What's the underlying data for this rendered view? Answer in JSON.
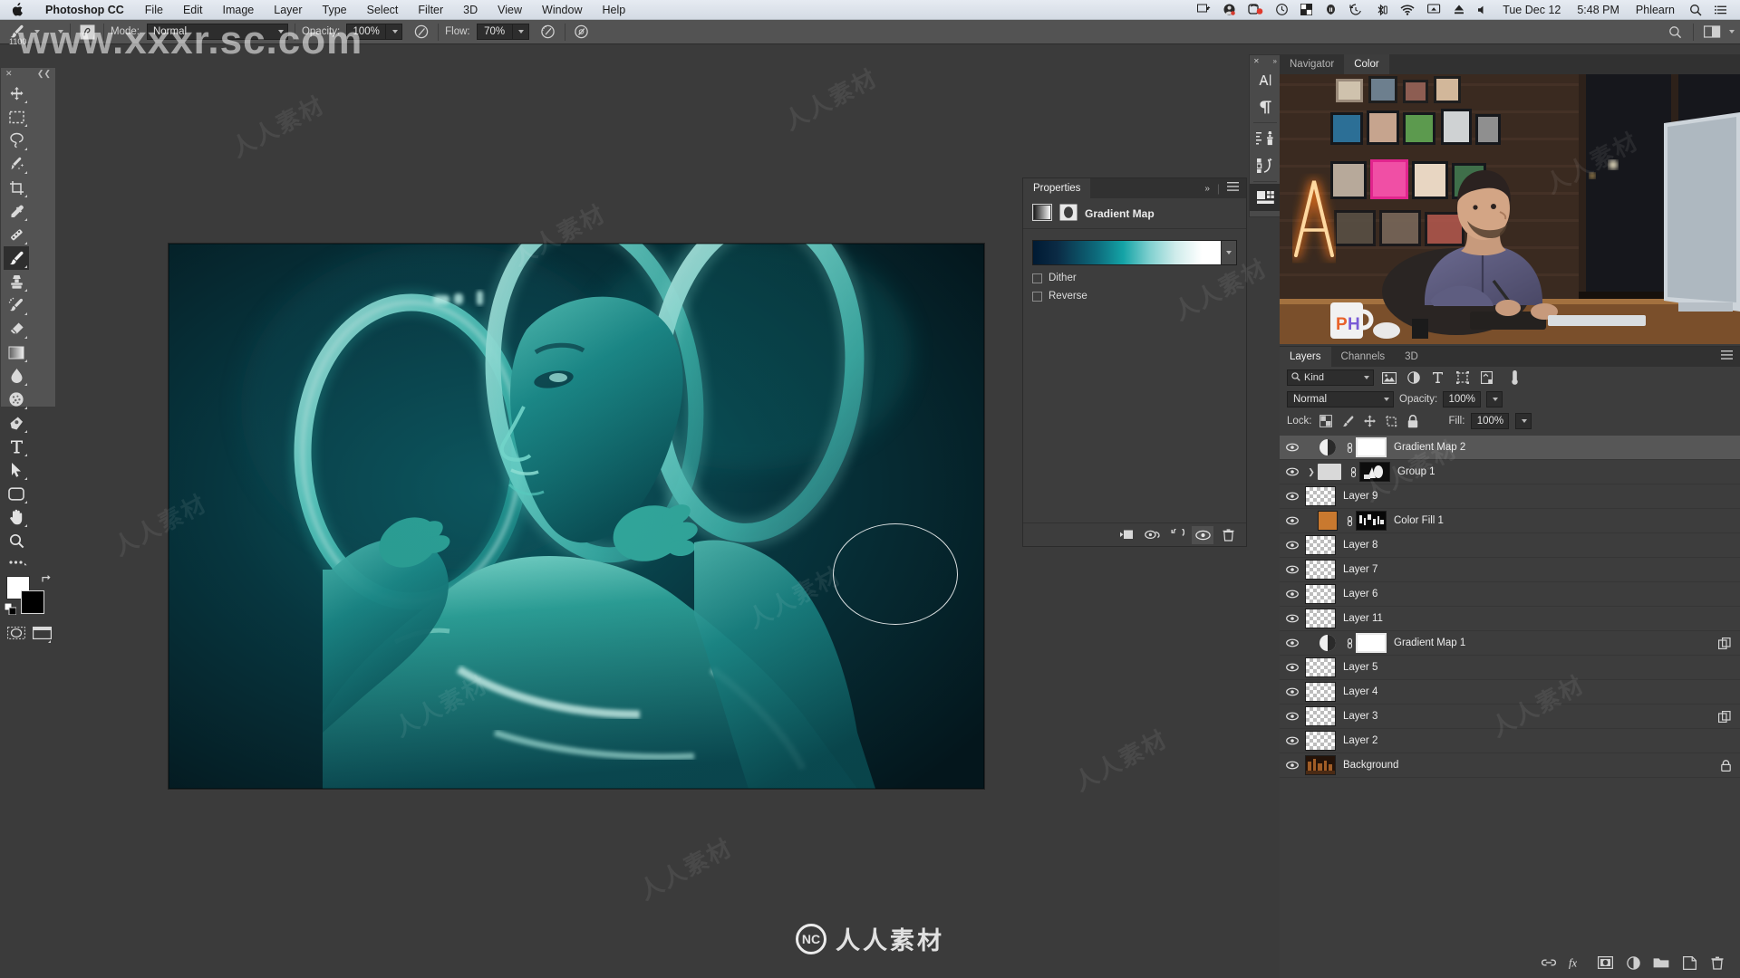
{
  "menubar": {
    "apple_icon": "apple-icon",
    "app_name": "Photoshop CC",
    "items": [
      "File",
      "Edit",
      "Image",
      "Layer",
      "Type",
      "Select",
      "Filter",
      "3D",
      "View",
      "Window",
      "Help"
    ],
    "status_icons": [
      "airplay-icon",
      "user-account-icon",
      "screen-record-icon",
      "clock-icon",
      "dropbox-icon",
      "cloud-icon",
      "timemachine-icon",
      "bluetooth-icon",
      "wifi-icon",
      "display-mirror-icon",
      "eject-icon",
      "volume-icon"
    ],
    "date": "Tue Dec 12",
    "time": "5:48 PM",
    "user": "Phlearn",
    "search_icon": "search-icon",
    "notification_icon": "notification-center-icon"
  },
  "optionsbar": {
    "tool_icon": "brush-tool-icon",
    "brush_size": "1100",
    "brush_preset_icon": "brush-preset-panel-icon",
    "mode_label": "Mode:",
    "mode_value": "Normal",
    "opacity_label": "Opacity:",
    "opacity_value": "100%",
    "opacity_pressure_icon": "pressure-opacity-icon",
    "flow_label": "Flow:",
    "flow_value": "70%",
    "airbrush_icon": "airbrush-icon",
    "smoothing_icon": "smoothing-icon",
    "search_icon": "search-icon",
    "workspace_icon": "workspace-switcher-icon"
  },
  "toolbar": {
    "close_icon": "close-icon",
    "collapse_icon": "collapse-icon",
    "tools": [
      {
        "name": "move-tool",
        "glyph": "move"
      },
      {
        "name": "rectangular-marquee-tool",
        "glyph": "marquee"
      },
      {
        "name": "lasso-tool",
        "glyph": "lasso"
      },
      {
        "name": "quick-selection-tool",
        "glyph": "wand"
      },
      {
        "name": "crop-tool",
        "glyph": "crop"
      },
      {
        "name": "eyedropper-tool",
        "glyph": "eyedropper"
      },
      {
        "name": "spot-healing-brush-tool",
        "glyph": "heal"
      },
      {
        "name": "brush-tool",
        "glyph": "brush",
        "selected": true
      },
      {
        "name": "clone-stamp-tool",
        "glyph": "stamp"
      },
      {
        "name": "history-brush-tool",
        "glyph": "historybrush"
      },
      {
        "name": "eraser-tool",
        "glyph": "eraser"
      },
      {
        "name": "gradient-tool",
        "glyph": "gradient"
      },
      {
        "name": "blur-tool",
        "glyph": "blur"
      },
      {
        "name": "dodge-tool",
        "glyph": "dodge"
      },
      {
        "name": "pen-tool",
        "glyph": "pen"
      },
      {
        "name": "type-tool",
        "glyph": "type"
      },
      {
        "name": "path-selection-tool",
        "glyph": "pathselect"
      },
      {
        "name": "rectangle-tool",
        "glyph": "rectangle"
      },
      {
        "name": "hand-tool",
        "glyph": "hand"
      },
      {
        "name": "zoom-tool",
        "glyph": "zoom"
      }
    ],
    "edit_toolbar_icon": "edit-toolbar-ellipsis-icon",
    "foreground_color": "#ffffff",
    "background_color": "#000000",
    "swap_colors_icon": "swap-colors-icon",
    "default_colors_icon": "default-colors-icon",
    "quick_mask_icon": "quick-mask-icon",
    "screen_mode_icon": "screen-mode-icon"
  },
  "properties": {
    "tab_label": "Properties",
    "collapse_icon": "chevrons-right-icon",
    "menu_icon": "panel-menu-icon",
    "adjustment_icon": "gradient-map-icon",
    "mask_icon": "layer-mask-icon",
    "title": "Gradient Map",
    "gradient_stops": [
      "#001a33",
      "#0d6b7c",
      "#14a3a6",
      "#cfeceb",
      "#ffffff"
    ],
    "gradient_dropdown_icon": "chevron-down-icon",
    "dither_label": "Dither",
    "dither_checked": false,
    "reverse_label": "Reverse",
    "reverse_checked": false,
    "footer_icons": [
      "clip-to-layer-icon",
      "view-previous-state-icon",
      "reset-icon",
      "toggle-visibility-icon",
      "delete-icon"
    ]
  },
  "rail": {
    "close_icon": "close-icon",
    "expand_icon": "chevrons-right-icon",
    "items": [
      "character-panel-icon",
      "paragraph-panel-icon",
      "brush-settings-icon",
      "brush-presets-icon",
      "tool-presets-icon"
    ]
  },
  "navigator": {
    "tabs": [
      {
        "label": "Navigator",
        "active": false
      },
      {
        "label": "Color",
        "active": true
      }
    ],
    "preview_name": "color-panel-video-preview"
  },
  "layers": {
    "tabs": [
      {
        "label": "Layers",
        "active": true
      },
      {
        "label": "Channels",
        "active": false
      },
      {
        "label": "3D",
        "active": false
      }
    ],
    "menu_icon": "panel-menu-icon",
    "filter": {
      "search_icon": "search-icon",
      "kind_label": "Kind",
      "chevron_icon": "chevron-down-icon",
      "type_filters": [
        "filter-pixel-icon",
        "filter-adjustment-icon",
        "filter-type-icon",
        "filter-shape-icon",
        "filter-smartobject-icon"
      ],
      "toggle_icon": "filter-toggle-icon"
    },
    "blend_mode": "Normal",
    "opacity_label": "Opacity:",
    "opacity_value": "100%",
    "lock_label": "Lock:",
    "lock_icons": [
      "lock-transparency-icon",
      "lock-image-icon",
      "lock-position-icon",
      "lock-artboard-icon",
      "lock-all-icon"
    ],
    "fill_label": "Fill:",
    "fill_value": "100%",
    "rows": [
      {
        "name": "Gradient Map 2",
        "type": "adjustment",
        "selected": true,
        "visible": true,
        "linked": true,
        "mask": true,
        "badge": null
      },
      {
        "name": "Group 1",
        "type": "group",
        "selected": false,
        "visible": true,
        "linked": true,
        "mask": true,
        "badge": null,
        "twisty": true
      },
      {
        "name": "Layer 9",
        "type": "pixel",
        "selected": false,
        "visible": true,
        "linked": false,
        "mask": false,
        "badge": null
      },
      {
        "name": "Color Fill 1",
        "type": "colorfill",
        "selected": false,
        "visible": true,
        "linked": true,
        "mask": true,
        "badge": null,
        "swatch": "#c9792f"
      },
      {
        "name": "Layer 8",
        "type": "pixel",
        "selected": false,
        "visible": true,
        "linked": false,
        "mask": false,
        "badge": null
      },
      {
        "name": "Layer 7",
        "type": "pixel",
        "selected": false,
        "visible": true,
        "linked": false,
        "mask": false,
        "badge": null
      },
      {
        "name": "Layer 6",
        "type": "pixel",
        "selected": false,
        "visible": true,
        "linked": false,
        "mask": false,
        "badge": null
      },
      {
        "name": "Layer 11",
        "type": "pixel",
        "selected": false,
        "visible": true,
        "linked": false,
        "mask": false,
        "badge": null
      },
      {
        "name": "Gradient Map 1",
        "type": "adjustment",
        "selected": false,
        "visible": true,
        "linked": true,
        "mask": true,
        "badge": "clipping-mask-icon"
      },
      {
        "name": "Layer 5",
        "type": "pixel",
        "selected": false,
        "visible": true,
        "linked": false,
        "mask": false,
        "badge": null
      },
      {
        "name": "Layer 4",
        "type": "pixel",
        "selected": false,
        "visible": true,
        "linked": false,
        "mask": false,
        "badge": null
      },
      {
        "name": "Layer 3",
        "type": "pixel",
        "selected": false,
        "visible": true,
        "linked": false,
        "mask": false,
        "badge": "clipping-mask-icon"
      },
      {
        "name": "Layer 2",
        "type": "pixel",
        "selected": false,
        "visible": true,
        "linked": false,
        "mask": false,
        "badge": null
      },
      {
        "name": "Background",
        "type": "background",
        "selected": false,
        "visible": true,
        "linked": false,
        "mask": false,
        "badge": "lock-icon"
      }
    ],
    "footer_icons": [
      "link-layers-icon",
      "fx-icon",
      "add-mask-icon",
      "new-adjustment-icon",
      "new-group-icon",
      "new-layer-icon",
      "delete-layer-icon"
    ]
  },
  "canvas": {
    "document_name": "photoshop-canvas-teal-gradient-map-portrait",
    "brush_cursor_name": "brush-cursor-circle"
  },
  "watermark": {
    "top_text": "www.xxxr.sc.com",
    "center_text": "人人素材",
    "center_mark": "NC"
  }
}
